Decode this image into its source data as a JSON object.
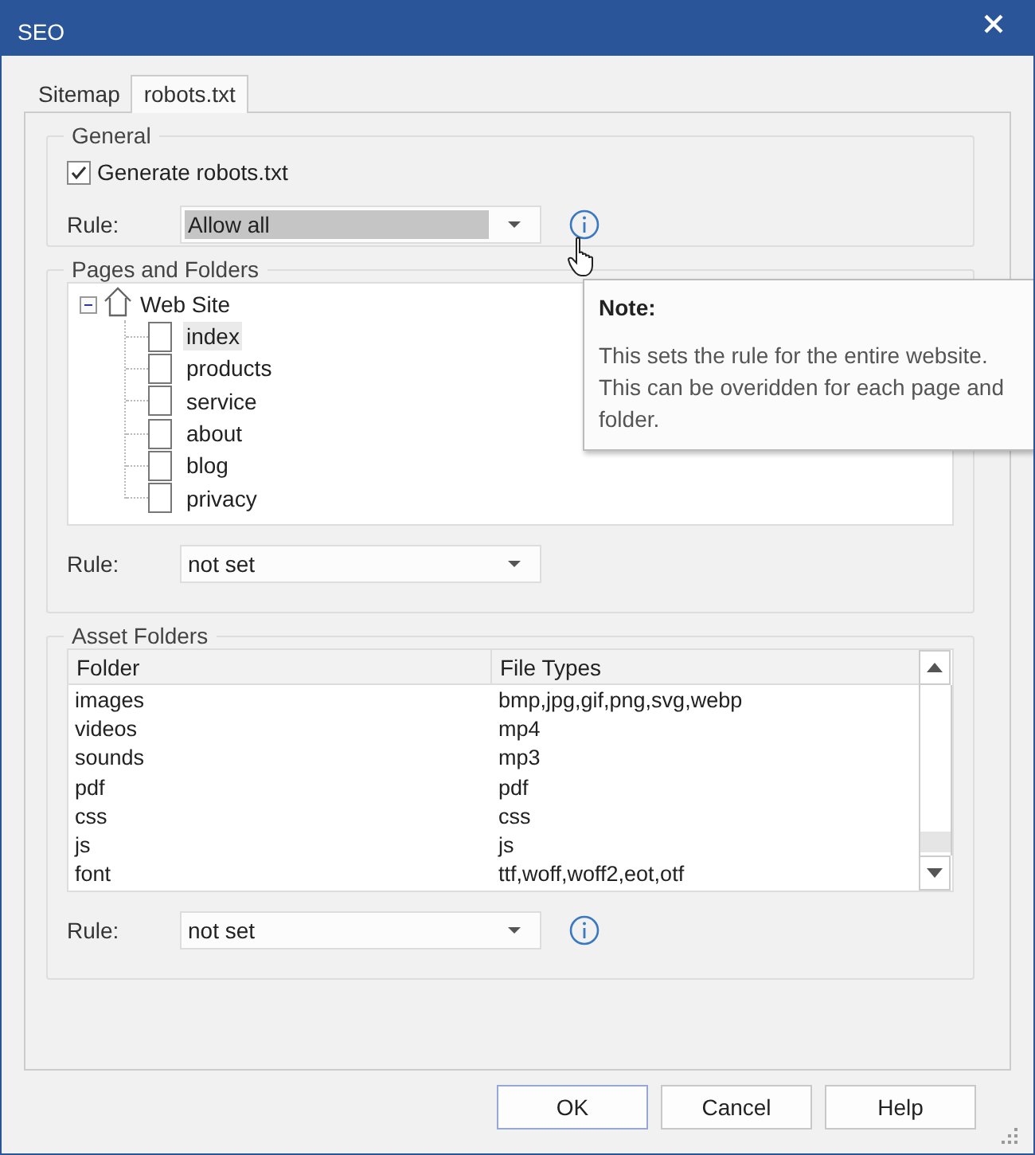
{
  "window": {
    "title": "SEO"
  },
  "tabs": [
    {
      "label": "Sitemap",
      "selected": false
    },
    {
      "label": "robots.txt",
      "selected": true
    }
  ],
  "general": {
    "title": "General",
    "generate": {
      "label": "Generate robots.txt",
      "checked": true
    },
    "rule": {
      "label": "Rule:",
      "value": "Allow all",
      "highlighted": true,
      "info_icon": true
    }
  },
  "pages": {
    "title": "Pages and Folders",
    "tree": {
      "label": "Web Site",
      "expanded": true,
      "children": [
        {
          "label": "index",
          "checked": false,
          "selected": true
        },
        {
          "label": "products",
          "checked": false,
          "selected": false
        },
        {
          "label": "service",
          "checked": false,
          "selected": false
        },
        {
          "label": "about",
          "checked": false,
          "selected": false
        },
        {
          "label": "blog",
          "checked": false,
          "selected": false
        },
        {
          "label": "privacy",
          "checked": false,
          "selected": false
        }
      ]
    },
    "rule": {
      "label": "Rule:",
      "value": "not set",
      "highlighted": false,
      "info_icon": false
    }
  },
  "assets": {
    "title": "Asset Folders",
    "columns": [
      "Folder",
      "File Types"
    ],
    "rows": [
      [
        "images",
        "bmp,jpg,gif,png,svg,webp"
      ],
      [
        "videos",
        "mp4"
      ],
      [
        "sounds",
        "mp3"
      ],
      [
        "pdf",
        "pdf"
      ],
      [
        "css",
        "css"
      ],
      [
        "js",
        "js"
      ],
      [
        "font",
        "ttf,woff,woff2,eot,otf"
      ]
    ],
    "rule": {
      "label": "Rule:",
      "value": "not set",
      "highlighted": false,
      "info_icon": true
    }
  },
  "tooltip": {
    "title": "Note:",
    "text": "This sets the rule for the entire website. This can be overidden for each page and folder."
  },
  "buttons": [
    {
      "label": "OK",
      "default": true
    },
    {
      "label": "Cancel",
      "default": false
    },
    {
      "label": "Help",
      "default": false
    }
  ]
}
